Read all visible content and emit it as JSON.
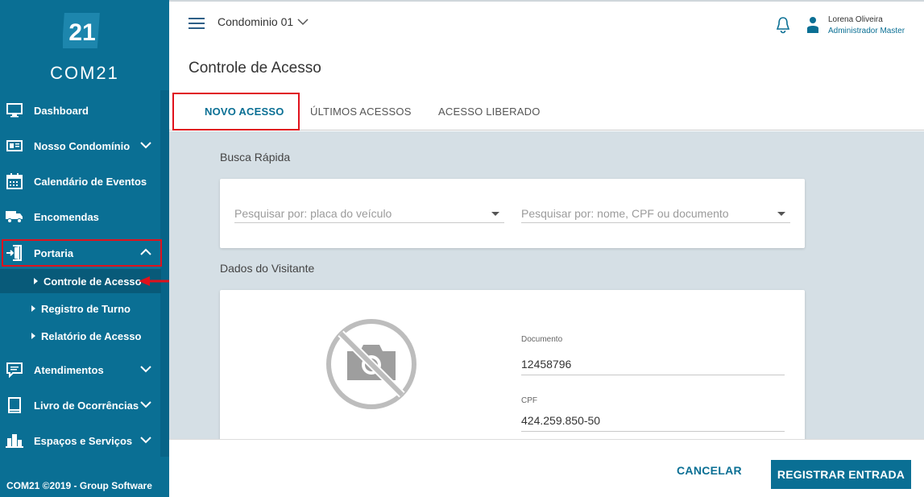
{
  "brand": {
    "logo_number": "21",
    "name": "COM21"
  },
  "sidebar": {
    "items": [
      {
        "label": "Dashboard",
        "icon": "monitor-icon"
      },
      {
        "label": "Nosso Condomínio",
        "icon": "building-card-icon"
      },
      {
        "label": "Calendário de Eventos",
        "icon": "calendar-icon"
      },
      {
        "label": "Encomendas",
        "icon": "truck-icon"
      },
      {
        "label": "Portaria",
        "icon": "door-enter-icon"
      },
      {
        "label": "Atendimentos",
        "icon": "chat-icon"
      },
      {
        "label": "Livro de Ocorrências",
        "icon": "book-icon"
      },
      {
        "label": "Espaços e Serviços",
        "icon": "city-icon"
      }
    ],
    "subitems": [
      {
        "label": "Controle de Acesso",
        "active": true
      },
      {
        "label": "Registro de Turno"
      },
      {
        "label": "Relatório de Acesso"
      }
    ],
    "footer": "COM21 ©2019 - Group Software"
  },
  "topbar": {
    "condo": "Condominio 01",
    "user_name": "Lorena Oliveira",
    "user_role": "Administrador Master"
  },
  "page": {
    "title": "Controle de Acesso"
  },
  "tabs": [
    {
      "label": "NOVO ACESSO",
      "active": true
    },
    {
      "label": "ÚLTIMOS ACESSOS"
    },
    {
      "label": "ACESSO LIBERADO"
    }
  ],
  "busca": {
    "title": "Busca Rápida",
    "placa_placeholder": "Pesquisar por: placa do veículo",
    "nome_placeholder": "Pesquisar por: nome, CPF ou documento"
  },
  "visitante": {
    "title": "Dados do Visitante",
    "documento_label": "Documento",
    "documento_value": "12458796",
    "cpf_label": "CPF",
    "cpf_value": "424.259.850-50"
  },
  "actions": {
    "cancel": "CANCELAR",
    "register": "REGISTRAR ENTRADA"
  },
  "colors": {
    "primary": "#0a6f94",
    "highlight": "#e0121c",
    "content_bg": "#d5dfe5"
  }
}
